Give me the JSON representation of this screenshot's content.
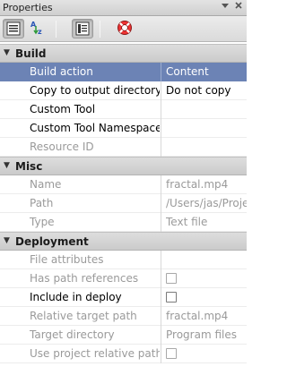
{
  "panel": {
    "title": "Properties"
  },
  "colors": {
    "selection": "#6c83b5",
    "section_bg": "#d4d4d4",
    "disabled_text": "#9a9a9a"
  },
  "toolbar": {
    "buttons": [
      {
        "icon": "categorized-view-icon",
        "pressed": true
      },
      {
        "icon": "sort-alphabetical-icon",
        "pressed": false
      },
      {
        "icon": "property-pages-icon",
        "pressed": true
      },
      {
        "icon": "help-lifebuoy-icon",
        "pressed": false
      }
    ]
  },
  "sections": [
    {
      "name": "Build",
      "properties": [
        {
          "name": "Build action",
          "value": "Content",
          "selected": true,
          "disabled": false
        },
        {
          "name": "Copy to output directory",
          "value": "Do not copy",
          "disabled": false
        },
        {
          "name": "Custom Tool",
          "value": "",
          "disabled": false
        },
        {
          "name": "Custom Tool Namespace",
          "value": "",
          "disabled": false
        },
        {
          "name": "Resource ID",
          "value": "",
          "disabled": true
        }
      ]
    },
    {
      "name": "Misc",
      "properties": [
        {
          "name": "Name",
          "value": "fractal.mp4",
          "disabled": true
        },
        {
          "name": "Path",
          "value": "/Users/jas/Proje",
          "disabled": true
        },
        {
          "name": "Type",
          "value": "Text file",
          "disabled": true
        }
      ]
    },
    {
      "name": "Deployment",
      "properties": [
        {
          "name": "File attributes",
          "value": "",
          "disabled": true
        },
        {
          "name": "Has path references",
          "checkbox": true,
          "checked": false,
          "disabled": true
        },
        {
          "name": "Include in deploy",
          "checkbox": true,
          "checked": false,
          "disabled": false
        },
        {
          "name": "Relative target path",
          "value": "fractal.mp4",
          "disabled": true
        },
        {
          "name": "Target directory",
          "value": "Program files",
          "disabled": true
        },
        {
          "name": "Use project relative path",
          "checkbox": true,
          "checked": false,
          "disabled": true
        }
      ]
    }
  ]
}
